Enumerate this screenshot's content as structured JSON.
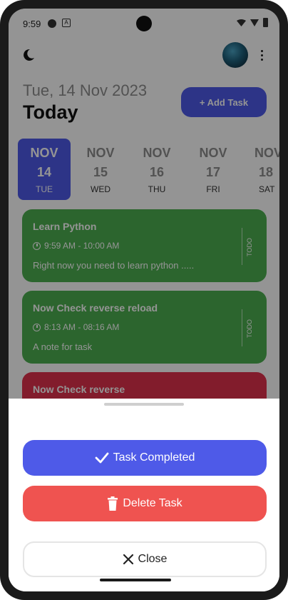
{
  "status_bar": {
    "time": "9:59"
  },
  "header": {
    "date_line": "Tue, 14 Nov 2023",
    "today_label": "Today",
    "add_task_label": "+ Add Task"
  },
  "date_picker": {
    "days": [
      {
        "month": "NOV",
        "day": "14",
        "weekday": "TUE",
        "selected": true
      },
      {
        "month": "NOV",
        "day": "15",
        "weekday": "WED",
        "selected": false
      },
      {
        "month": "NOV",
        "day": "16",
        "weekday": "THU",
        "selected": false
      },
      {
        "month": "NOV",
        "day": "17",
        "weekday": "FRI",
        "selected": false
      },
      {
        "month": "NOV",
        "day": "18",
        "weekday": "SAT",
        "selected": false
      }
    ]
  },
  "tasks": [
    {
      "title": "Learn Python",
      "time": "9:59 AM - 10:00 AM",
      "note": "Right now you need to learn python .....",
      "status": "TODO",
      "color": "#4caf50"
    },
    {
      "title": "Now Check reverse reload",
      "time": "8:13 AM - 08:16 AM",
      "note": "A note for task",
      "status": "TODO",
      "color": "#4caf50"
    },
    {
      "title": "Now Check reverse",
      "time": "",
      "note": "",
      "status": "",
      "color": "#e0314c"
    }
  ],
  "sheet": {
    "complete_label": "Task Completed",
    "delete_label": "Delete Task",
    "close_label": "Close"
  },
  "colors": {
    "primary": "#4e5ae8",
    "delete": "#ef5350",
    "task_green": "#4caf50",
    "task_red": "#e0314c"
  }
}
